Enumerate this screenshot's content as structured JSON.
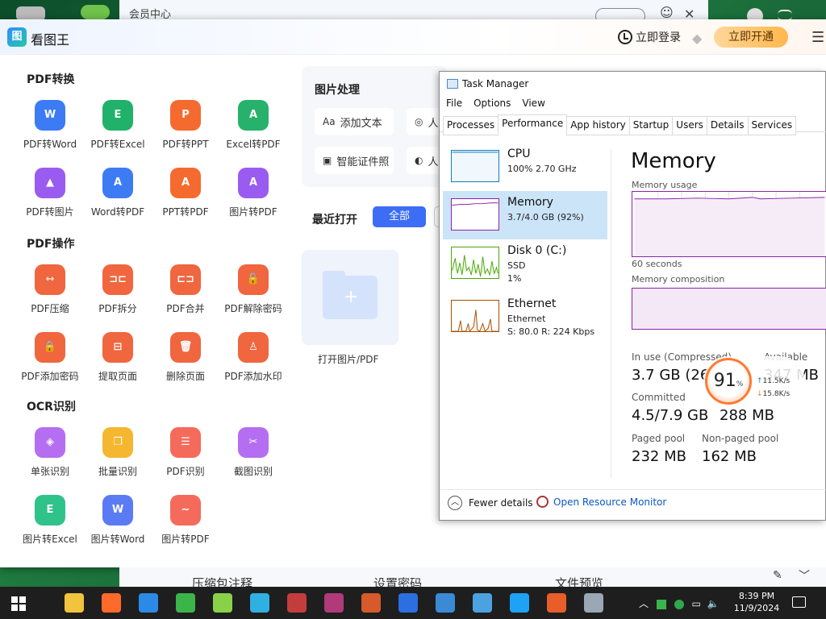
{
  "background_window": {
    "title": "会员中心"
  },
  "app": {
    "title": "看图王",
    "login_label": "立即登录",
    "vip_button": "立即开通"
  },
  "sections": [
    {
      "title": "PDF转换",
      "tools": [
        {
          "label": "PDF转Word",
          "icon": "pdf-to-word-icon",
          "glyph": "W",
          "color": "#3d7bf5"
        },
        {
          "label": "PDF转Excel",
          "icon": "pdf-to-excel-icon",
          "glyph": "E",
          "color": "#20b26b"
        },
        {
          "label": "PDF转PPT",
          "icon": "pdf-to-ppt-icon",
          "glyph": "P",
          "color": "#f56b2f"
        },
        {
          "label": "Excel转PDF",
          "icon": "excel-to-pdf-icon",
          "glyph": "A",
          "color": "#27b26b"
        },
        {
          "label": "PDF转图片",
          "icon": "pdf-to-image-icon",
          "glyph": "▲",
          "color": "#9a5bf0"
        },
        {
          "label": "Word转PDF",
          "icon": "word-to-pdf-icon",
          "glyph": "A",
          "color": "#3d7bf5"
        },
        {
          "label": "PPT转PDF",
          "icon": "ppt-to-pdf-icon",
          "glyph": "A",
          "color": "#f56b2f"
        },
        {
          "label": "图片转PDF",
          "icon": "image-to-pdf-icon",
          "glyph": "A",
          "color": "#9a5bf0"
        }
      ]
    },
    {
      "title": "PDF操作",
      "tools": [
        {
          "label": "PDF压缩",
          "icon": "compress-icon",
          "glyph": "⇿",
          "color": "#f0663f"
        },
        {
          "label": "PDF拆分",
          "icon": "split-icon",
          "glyph": "⊐⊏",
          "color": "#f0663f"
        },
        {
          "label": "PDF合并",
          "icon": "merge-icon",
          "glyph": "⊏⊐",
          "color": "#f0663f"
        },
        {
          "label": "PDF解除密码",
          "icon": "unlock-icon",
          "glyph": "🔓",
          "color": "#f0663f"
        },
        {
          "label": "PDF添加密码",
          "icon": "lock-icon",
          "glyph": "🔒",
          "color": "#f0663f"
        },
        {
          "label": "提取页面",
          "icon": "extract-page-icon",
          "glyph": "⊟",
          "color": "#f0663f"
        },
        {
          "label": "删除页面",
          "icon": "delete-page-icon",
          "glyph": "🗑",
          "color": "#f0663f"
        },
        {
          "label": "PDF添加水印",
          "icon": "watermark-icon",
          "glyph": "♙",
          "color": "#f0663f"
        }
      ]
    },
    {
      "title": "OCR识别",
      "tools": [
        {
          "label": "单张识别",
          "icon": "single-ocr-icon",
          "glyph": "◈",
          "color": "#b56ef2"
        },
        {
          "label": "批量识别",
          "icon": "batch-ocr-icon",
          "glyph": "❐",
          "color": "#f5b72f"
        },
        {
          "label": "PDF识别",
          "icon": "pdf-ocr-icon",
          "glyph": "☰",
          "color": "#f56b5b"
        },
        {
          "label": "截图识别",
          "icon": "screenshot-ocr-icon",
          "glyph": "✂",
          "color": "#b56ef2"
        },
        {
          "label": "图片转Excel",
          "icon": "image-to-excel-icon",
          "glyph": "E",
          "color": "#2fc28a"
        },
        {
          "label": "图片转Word",
          "icon": "image-to-word-icon",
          "glyph": "W",
          "color": "#5b7bf5"
        },
        {
          "label": "图片转PDF",
          "icon": "image-to-pdf-ocr-icon",
          "glyph": "∼",
          "color": "#f56b5b"
        }
      ]
    }
  ],
  "image_processing": {
    "title": "图片处理",
    "chips": [
      {
        "label": "添加文本",
        "glyph": "Aa"
      },
      {
        "label": "人",
        "glyph": "◎"
      },
      {
        "label": "智能证件照",
        "glyph": "▣"
      },
      {
        "label": "人",
        "glyph": "◐"
      }
    ]
  },
  "recent": {
    "title": "最近打开",
    "all_button": "全部",
    "open_label": "打开图片/PDF"
  },
  "task_manager": {
    "title": "Task Manager",
    "menu": [
      "File",
      "Options",
      "View"
    ],
    "tabs": [
      "Processes",
      "Performance",
      "App history",
      "Startup",
      "Users",
      "Details",
      "Services"
    ],
    "active_tab": "Performance",
    "resources": [
      {
        "name": "CPU",
        "sub1": "100%  2.70 GHz",
        "sub2": "",
        "color": "#117dbb"
      },
      {
        "name": "Memory",
        "sub1": "3.7/4.0 GB (92%)",
        "sub2": "",
        "color": "#8b23a8"
      },
      {
        "name": "Disk 0 (C:)",
        "sub1": "SSD",
        "sub2": "1%",
        "color": "#4da60c"
      },
      {
        "name": "Ethernet",
        "sub1": "Ethernet",
        "sub2": "S: 80.0  R: 224 Kbps",
        "color": "#a74f01"
      }
    ],
    "detail": {
      "heading": "Memory",
      "usage_label": "Memory usage",
      "seconds_label": "60 seconds",
      "composition_label": "Memory composition",
      "in_use_label": "In use (Compressed)",
      "in_use_value": "3.7 GB (26",
      "available_label": "Available",
      "available_value": "347 MB",
      "committed_label": "Committed",
      "committed_value": "4.5/7.9 GB",
      "cached_value": "288 MB",
      "paged_label": "Paged pool",
      "paged_value": "232 MB",
      "nonpaged_label": "Non-paged pool",
      "nonpaged_value": "162 MB"
    },
    "fewer_details": "Fewer details",
    "open_resource_monitor": "Open Resource Monitor"
  },
  "speed_widget": {
    "percent": "91",
    "unit": "%",
    "up": "11.5K/s",
    "down": "15.8K/s"
  },
  "bottom_window": [
    "压缩包注释",
    "设置密码",
    "文件预览"
  ],
  "taskbar": {
    "time": "8:39 PM",
    "date": "11/9/2024",
    "icons": [
      {
        "name": "file-explorer-icon",
        "color": "#f2c33d"
      },
      {
        "name": "firefox-icon",
        "color": "#ff6a2a"
      },
      {
        "name": "edge-icon",
        "color": "#2b8ae6"
      },
      {
        "name": "people-icon",
        "color": "#3bb54a"
      },
      {
        "name": "package-icon",
        "color": "#8ad14a"
      },
      {
        "name": "image-viewer-icon",
        "color": "#2fb0e0"
      },
      {
        "name": "archive-icon",
        "color": "#c43d3d"
      },
      {
        "name": "winrar-icon",
        "color": "#b03a7a"
      },
      {
        "name": "books-icon",
        "color": "#d65a2a"
      },
      {
        "name": "shield-icon",
        "color": "#2c6fe0"
      },
      {
        "name": "screen-icon",
        "color": "#3a8ad6"
      },
      {
        "name": "clipboard-icon",
        "color": "#4aa3e0"
      },
      {
        "name": "p-app-icon",
        "color": "#1ea2f5"
      },
      {
        "name": "windows-tiles-icon",
        "color": "#e85d2a"
      },
      {
        "name": "task-manager-taskbar-icon",
        "color": "#9aa7b5"
      }
    ]
  }
}
